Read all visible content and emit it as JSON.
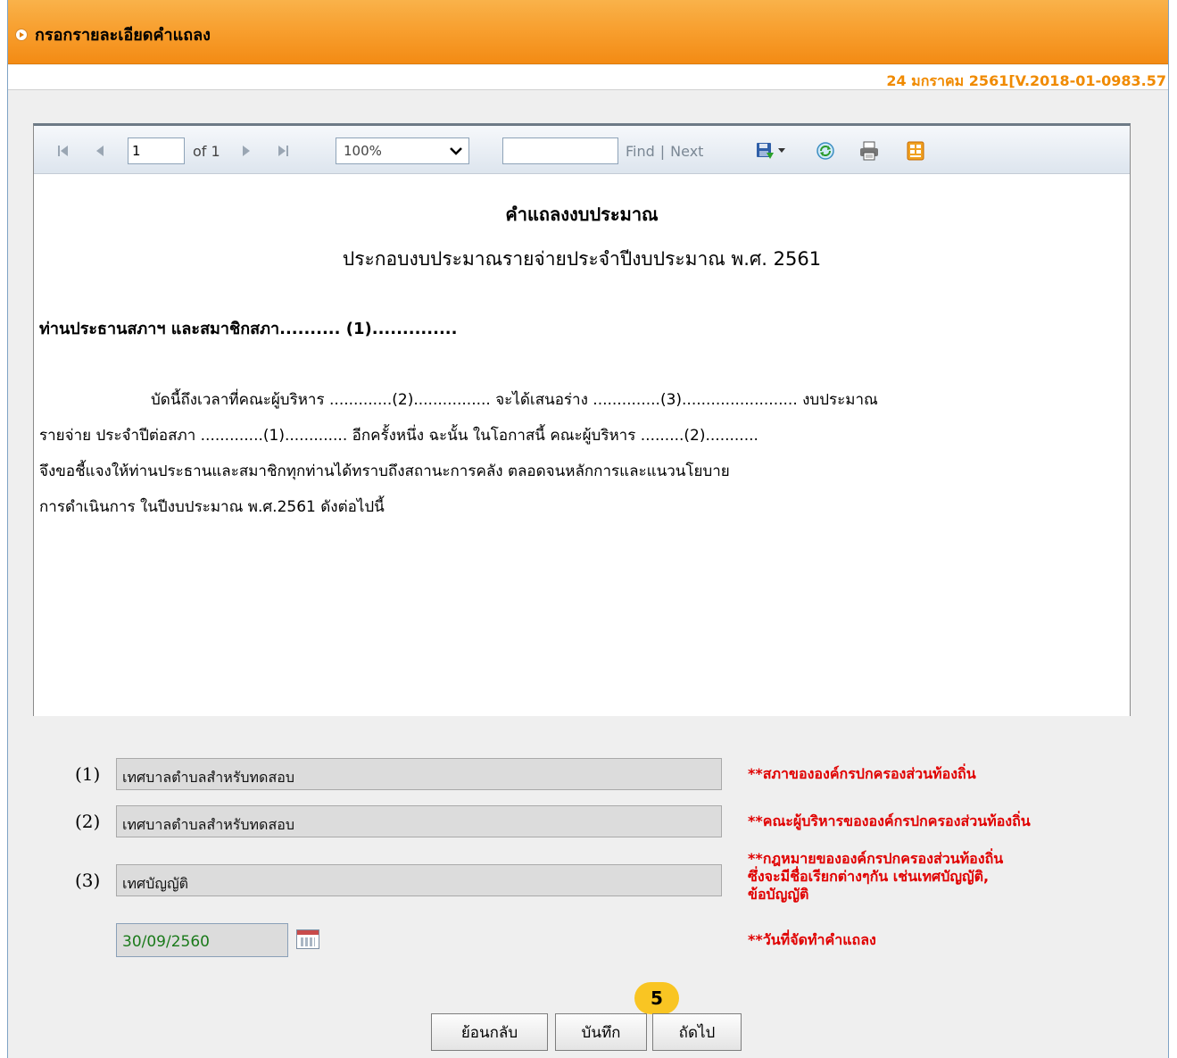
{
  "header": {
    "title": "กรอกรายละเอียดคำแถลง"
  },
  "version": "24 มกราคม 2561[V.2018-01-0983.57",
  "toolbar": {
    "page_value": "1",
    "of_label": "of 1",
    "zoom_value": "100%",
    "find_label": "Find",
    "separator": "|",
    "next_label": "Next"
  },
  "document": {
    "title": "คำแถลงงบประมาณ",
    "subtitle": "ประกอบงบประมาณรายจ่ายประจำปีงบประมาณ พ.ศ. 2561",
    "salutation": "ท่านประธานสภาฯ และสมาชิกสภา.......... (1)..............",
    "lines": [
      "บัดนี้ถึงเวลาที่คณะผู้บริหาร .............(2)................ จะได้เสนอร่าง ..............(3)........................ งบประมาณ",
      "รายจ่าย ประจำปีต่อสภา .............(1)............. อีกครั้งหนึ่ง ฉะนั้น ในโอกาสนี้ คณะผู้บริหาร .........(2)...........",
      "จึงขอชี้แจงให้ท่านประธานและสมาชิกทุกท่านได้ทราบถึงสถานะการคลัง ตลอดจนหลักการและแนวนโยบาย",
      "การดำเนินการ ในปีงบประมาณ พ.ศ.2561 ดังต่อไปนี้"
    ]
  },
  "form": {
    "field1": {
      "label": "(1)",
      "value": "เทศบาลตำบลสำหรับทดสอบ",
      "note": "**สภาขององค์กรปกครองส่วนท้องถิ่น"
    },
    "field2": {
      "label": "(2)",
      "value": "เทศบาลตำบลสำหรับทดสอบ",
      "note": "**คณะผู้บริหารขององค์กรปกครองส่วนท้องถิ่น"
    },
    "field3": {
      "label": "(3)",
      "value": "เทศบัญญัติ",
      "note_lines": [
        "**กฎหมายขององค์กรปกครองส่วนท้องถิ่น",
        "ซึ่งจะมีชื่อเรียกต่างๆกัน เช่นเทศบัญญัติ,",
        "ข้อบัญญัติ"
      ]
    },
    "date": {
      "value": "30/09/2560",
      "note": "**วันที่จัดทำคำแถลง"
    }
  },
  "buttons": {
    "back": "ย้อนกลับ",
    "save": "บันทึก",
    "next": "ถัดไป"
  },
  "badge": "5",
  "colors": {
    "header_orange": "#f8a030",
    "version_orange": "#f08a00",
    "note_red": "#e00000",
    "date_green": "#1a7a1a"
  }
}
